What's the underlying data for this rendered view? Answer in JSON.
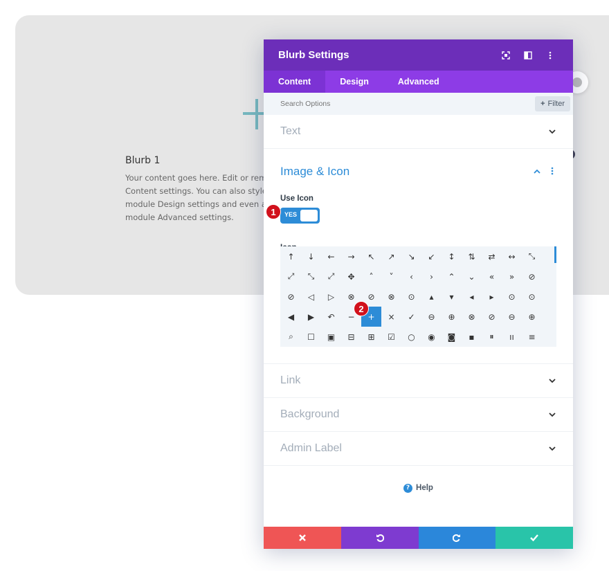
{
  "blurb": {
    "title": "Blurb 1",
    "body_lines": [
      "Your content goes here. Edit or remove",
      "Content settings. You can also style ev",
      "module Design settings and even appl",
      "module Advanced settings."
    ]
  },
  "panel": {
    "title": "Blurb Settings",
    "header_icons": [
      "expand-icon",
      "split-view-icon",
      "more-icon"
    ],
    "tabs": [
      {
        "label": "Content",
        "active": true
      },
      {
        "label": "Design",
        "active": false
      },
      {
        "label": "Advanced",
        "active": false
      }
    ],
    "search": {
      "placeholder": "Search Options",
      "filter_label": "Filter"
    },
    "sections": {
      "text": "Text",
      "image_icon": "Image & Icon",
      "link": "Link",
      "background": "Background",
      "admin_label": "Admin Label"
    },
    "use_icon": {
      "label": "Use Icon",
      "toggle_text": "YES"
    },
    "icon_label": "Icon",
    "icons": [
      "↑",
      "↓",
      "←",
      "→",
      "↖",
      "↗",
      "↘",
      "↙",
      "↕",
      "⇅",
      "⇄",
      "↔",
      "⤡",
      "⤢",
      "⤡",
      "⤢",
      "✥",
      "˄",
      "˅",
      "‹",
      "›",
      "⌃",
      "⌄",
      "«",
      "»",
      "⊘",
      "⊘",
      "◁",
      "▷",
      "⊗",
      "⊘",
      "⊗",
      "⊙",
      "▴",
      "▾",
      "◂",
      "▸",
      "⊙",
      "⊙",
      "◀",
      "▶",
      "↶",
      "−",
      "+",
      "×",
      "✓",
      "⊖",
      "⊕",
      "⊗",
      "⊘",
      "⊖",
      "⊕",
      "⌕",
      "☐",
      "▣",
      "⊟",
      "⊞",
      "☑",
      "○",
      "◉",
      "◙",
      "▪",
      "⏸",
      "ıı",
      "≡"
    ],
    "selected_icon_index": 43,
    "help_label": "Help",
    "colors": {
      "header": "#6c2eb9",
      "tabs": "#8d3ce6",
      "accent": "#2d8cd7",
      "cancel": "#ef5555",
      "undo": "#7e3bd0",
      "redo": "#2b87da",
      "save": "#29c4a9"
    }
  },
  "badges": {
    "step1": "1",
    "step2": "2"
  }
}
